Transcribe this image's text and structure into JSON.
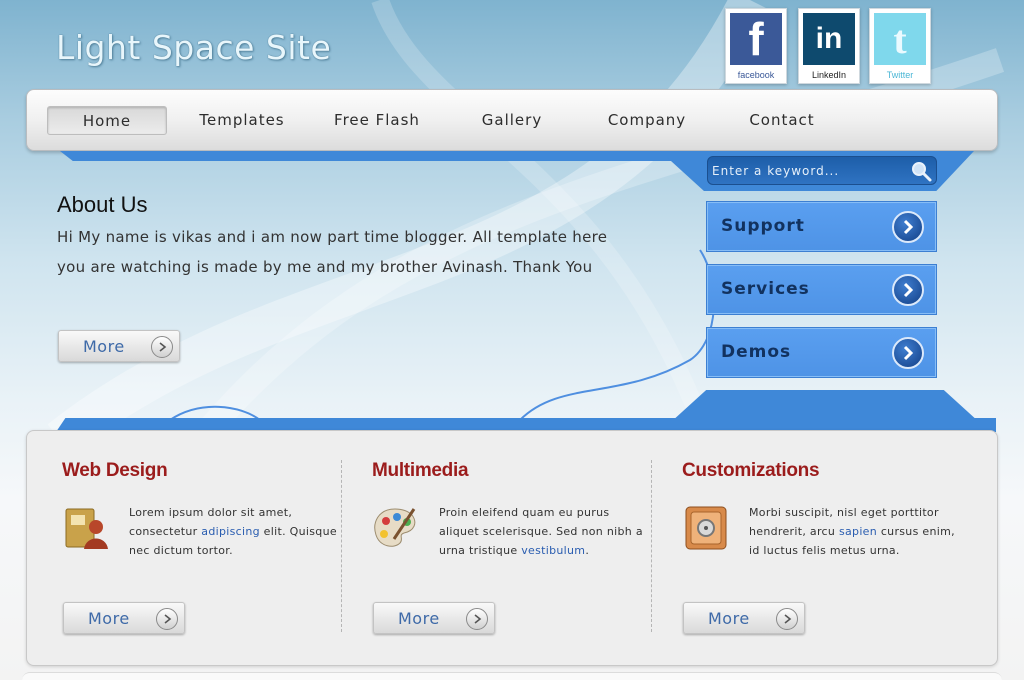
{
  "site": {
    "title": "Light Space Site"
  },
  "social": [
    {
      "name": "facebook",
      "glyph": "f",
      "caption": "facebook"
    },
    {
      "name": "linkedin",
      "glyph": "in",
      "caption": "LinkedIn"
    },
    {
      "name": "twitter",
      "glyph": "t",
      "caption": "Twitter"
    }
  ],
  "nav": {
    "items": [
      {
        "label": "Home",
        "active": true
      },
      {
        "label": "Templates"
      },
      {
        "label": "Free Flash"
      },
      {
        "label": "Gallery"
      },
      {
        "label": "Company"
      },
      {
        "label": "Contact"
      }
    ]
  },
  "search": {
    "placeholder": "Enter a keyword..."
  },
  "sidebar": {
    "buttons": [
      {
        "label": "Support"
      },
      {
        "label": "Services"
      },
      {
        "label": "Demos"
      }
    ]
  },
  "about": {
    "title": "About Us",
    "text": "Hi My name is vikas and i am now part time blogger. All template here you are watching is made by me and my brother Avinash. Thank You",
    "more_label": "More"
  },
  "columns": [
    {
      "title": "Web Design",
      "icon": "contact-book-icon",
      "text_before": "Lorem ipsum dolor sit amet, consectetur ",
      "link": "adipiscing",
      "text_after": " elit. Quisque nec dictum tortor.",
      "more_label": "More"
    },
    {
      "title": "Multimedia",
      "icon": "paint-palette-icon",
      "text_before": "Proin eleifend quam eu purus aliquet scelerisque. Sed non nibh a urna tristique ",
      "link": "vestibulum",
      "text_after": ".",
      "more_label": "More"
    },
    {
      "title": "Customizations",
      "icon": "safe-icon",
      "text_before": "Morbi suscipit, nisl eget porttitor hendrerit, arcu ",
      "link": "sapien",
      "text_after": " cursus enim, id luctus felis metus urna.",
      "more_label": "More"
    }
  ],
  "colors": {
    "accent_blue": "#3f88d8",
    "title_red": "#9b1c1c",
    "link_blue": "#2a5db0"
  }
}
